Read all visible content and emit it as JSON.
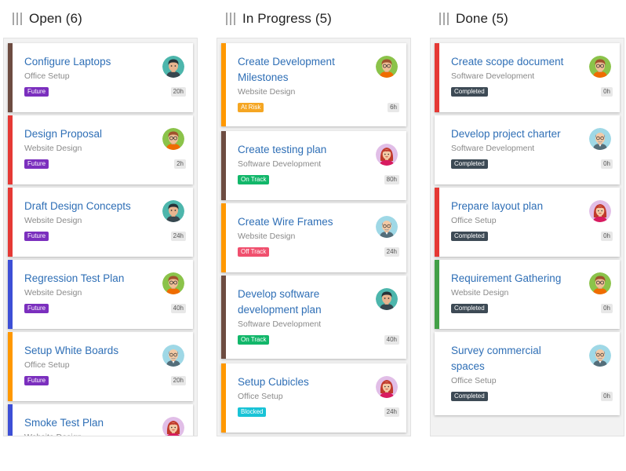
{
  "colors": {
    "brown": "#6d4c41",
    "red": "#e53935",
    "indigo": "#3d4fd6",
    "orange": "#ff9800",
    "green": "#43a047",
    "future": "#7b2fbe",
    "at_risk": "#f5a623",
    "on_track": "#12b76a",
    "off_track": "#f0506e",
    "blocked": "#19c3d6",
    "completed": "#3d4a55"
  },
  "columns": [
    {
      "title": "Open (6)",
      "cards": [
        {
          "title": "Configure Laptops",
          "project": "Office Setup",
          "status": "Future",
          "hours": "20h",
          "accent": "brown",
          "avatar": "man-dark",
          "status_color": "future"
        },
        {
          "title": "Design Proposal",
          "project": "Website Design",
          "status": "Future",
          "hours": "2h",
          "accent": "red",
          "avatar": "man-glasses",
          "status_color": "future"
        },
        {
          "title": "Draft Design Concepts",
          "project": "Website Design",
          "status": "Future",
          "hours": "24h",
          "accent": "red",
          "avatar": "man-dark",
          "status_color": "future"
        },
        {
          "title": "Regression Test Plan",
          "project": "Website Design",
          "status": "Future",
          "hours": "40h",
          "accent": "indigo",
          "avatar": "man-glasses",
          "status_color": "future"
        },
        {
          "title": "Setup White Boards",
          "project": "Office Setup",
          "status": "Future",
          "hours": "20h",
          "accent": "orange",
          "avatar": "man-bald",
          "status_color": "future"
        },
        {
          "title": "Smoke Test Plan",
          "project": "Website Design",
          "status": "",
          "hours": "",
          "accent": "indigo",
          "avatar": "woman",
          "status_color": "future"
        }
      ]
    },
    {
      "title": "In Progress (5)",
      "cards": [
        {
          "title": "Create Development Milestones",
          "project": "Website Design",
          "status": "At Risk",
          "hours": "6h",
          "accent": "orange",
          "avatar": "man-glasses",
          "status_color": "at_risk"
        },
        {
          "title": "Create testing plan",
          "project": "Software Development",
          "status": "On Track",
          "hours": "80h",
          "accent": "brown",
          "avatar": "woman",
          "status_color": "on_track"
        },
        {
          "title": "Create Wire Frames",
          "project": "Website Design",
          "status": "Off Track",
          "hours": "24h",
          "accent": "orange",
          "avatar": "man-bald",
          "status_color": "off_track"
        },
        {
          "title": "Develop software development plan",
          "project": "Software Development",
          "status": "On Track",
          "hours": "40h",
          "accent": "brown",
          "avatar": "man-dark",
          "status_color": "on_track"
        },
        {
          "title": "Setup Cubicles",
          "project": "Office Setup",
          "status": "Blocked",
          "hours": "24h",
          "accent": "orange",
          "avatar": "woman",
          "status_color": "blocked"
        }
      ]
    },
    {
      "title": "Done (5)",
      "cards": [
        {
          "title": "Create scope document",
          "project": "Software Development",
          "status": "Completed",
          "hours": "0h",
          "accent": "red",
          "avatar": "man-glasses",
          "status_color": "completed"
        },
        {
          "title": "Develop project charter",
          "project": "Software Development",
          "status": "Completed",
          "hours": "0h",
          "accent": "",
          "avatar": "man-bald",
          "status_color": "completed"
        },
        {
          "title": "Prepare layout plan",
          "project": "Office Setup",
          "status": "Completed",
          "hours": "0h",
          "accent": "red",
          "avatar": "woman",
          "status_color": "completed"
        },
        {
          "title": "Requirement Gathering",
          "project": "Website Design",
          "status": "Completed",
          "hours": "0h",
          "accent": "green",
          "avatar": "man-glasses",
          "status_color": "completed"
        },
        {
          "title": "Survey commercial spaces",
          "project": "Office Setup",
          "status": "Completed",
          "hours": "0h",
          "accent": "",
          "avatar": "man-bald",
          "status_color": "completed"
        }
      ]
    }
  ]
}
